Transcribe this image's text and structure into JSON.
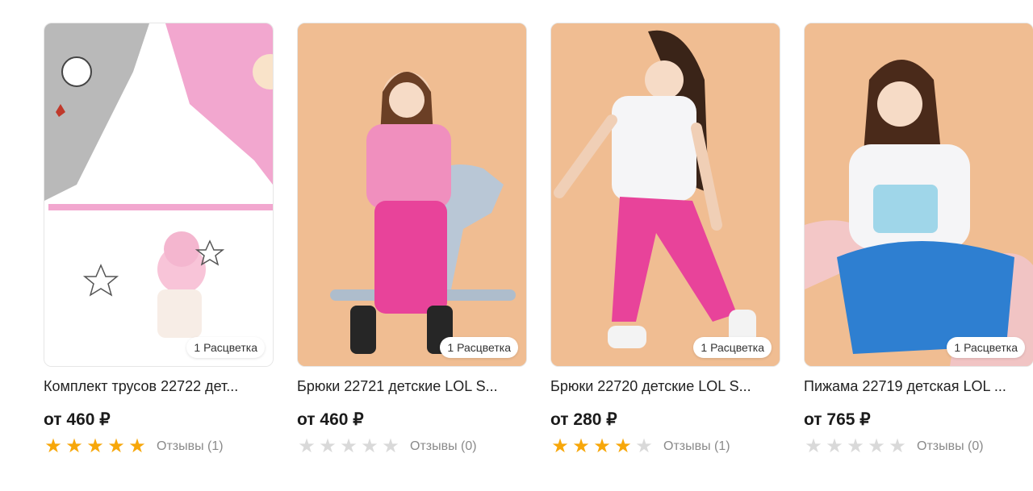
{
  "colors": {
    "star_active": "#f7a70a",
    "star_inactive": "#d9d9d9",
    "photo_bg": "#f3c69a"
  },
  "products": [
    {
      "title": "Комплект трусов 22722 дет...",
      "price": "от 460 ₽",
      "badge": "1 Расцветка",
      "rating": 5,
      "reviews": "Отзывы (1)"
    },
    {
      "title": "Брюки 22721 детские LOL S...",
      "price": "от 460 ₽",
      "badge": "1 Расцветка",
      "rating": 0,
      "reviews": "Отзывы (0)"
    },
    {
      "title": "Брюки 22720 детские LOL S...",
      "price": "от 280 ₽",
      "badge": "1 Расцветка",
      "rating": 4,
      "reviews": "Отзывы (1)"
    },
    {
      "title": "Пижама 22719 детская LOL ...",
      "price": "от 765 ₽",
      "badge": "1 Расцветка",
      "rating": 0,
      "reviews": "Отзывы (0)"
    }
  ]
}
